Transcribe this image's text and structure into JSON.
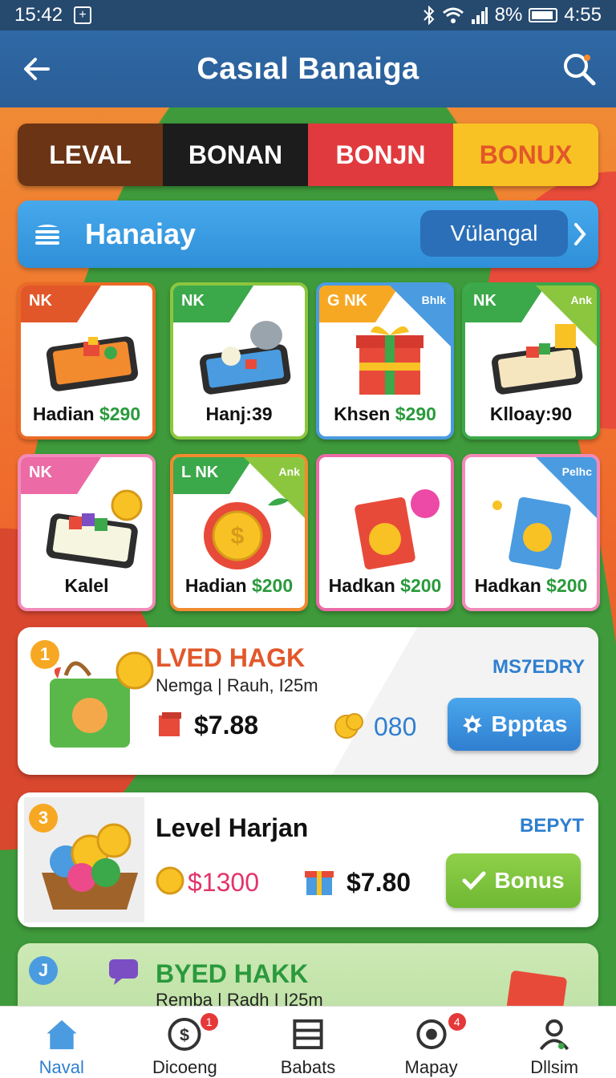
{
  "status": {
    "time_left": "15:42",
    "battery": "8%",
    "time_right": "4:55"
  },
  "header": {
    "title": "Casıal Banaiga"
  },
  "tabs": [
    {
      "label": "LEVAL"
    },
    {
      "label": "BONAN"
    },
    {
      "label": "BONJN"
    },
    {
      "label": "BONUX"
    }
  ],
  "section": {
    "title": "Hanaiay",
    "pill": "Vülangal"
  },
  "cards": [
    {
      "ribbon": "NK",
      "corner": "",
      "name": "Hadian",
      "price": "$290"
    },
    {
      "ribbon": "NK",
      "corner": "",
      "name": "Hanj:39",
      "price": ""
    },
    {
      "ribbon": "G NK",
      "corner": "Bhlk",
      "name": "Khsen",
      "price": "$290"
    },
    {
      "ribbon": "NK",
      "corner": "Ank",
      "name": "Klloay:90",
      "price": ""
    },
    {
      "ribbon": "NK",
      "corner": "",
      "name": "Kalel",
      "price": ""
    },
    {
      "ribbon": "L NK",
      "corner": "Ank",
      "name": "Hadian",
      "price": "$200"
    },
    {
      "ribbon": "",
      "corner": "",
      "name": "Hadkan",
      "price": "$200"
    },
    {
      "ribbon": "",
      "corner": "Pelhc",
      "name": "Hadkan",
      "price": "$200"
    }
  ],
  "rows": [
    {
      "num": "1",
      "title": "LVED HAGK",
      "subtitle": "Nemga | Rauh, I25m",
      "tag": "MS7EDRY",
      "value1": "$7.88",
      "value2": "080",
      "button": "Bpptas"
    },
    {
      "num": "3",
      "title": "Level Harjan",
      "tag": "BEPYT",
      "value1": "$1300",
      "value2": "$7.80",
      "button": "Bonus"
    },
    {
      "num": "J",
      "title": "BYED HAKK",
      "subtitle": "Remba | Radh I I25m"
    }
  ],
  "nav": [
    {
      "label": "Naval",
      "badge": ""
    },
    {
      "label": "Dicoeng",
      "badge": "1"
    },
    {
      "label": "Babats",
      "badge": ""
    },
    {
      "label": "Mapay",
      "badge": "4"
    },
    {
      "label": "Dllsim",
      "badge": ""
    }
  ],
  "colors": {
    "header": "#2f69a6",
    "green": "#2a9a3c",
    "blue": "#2f7fd0"
  }
}
